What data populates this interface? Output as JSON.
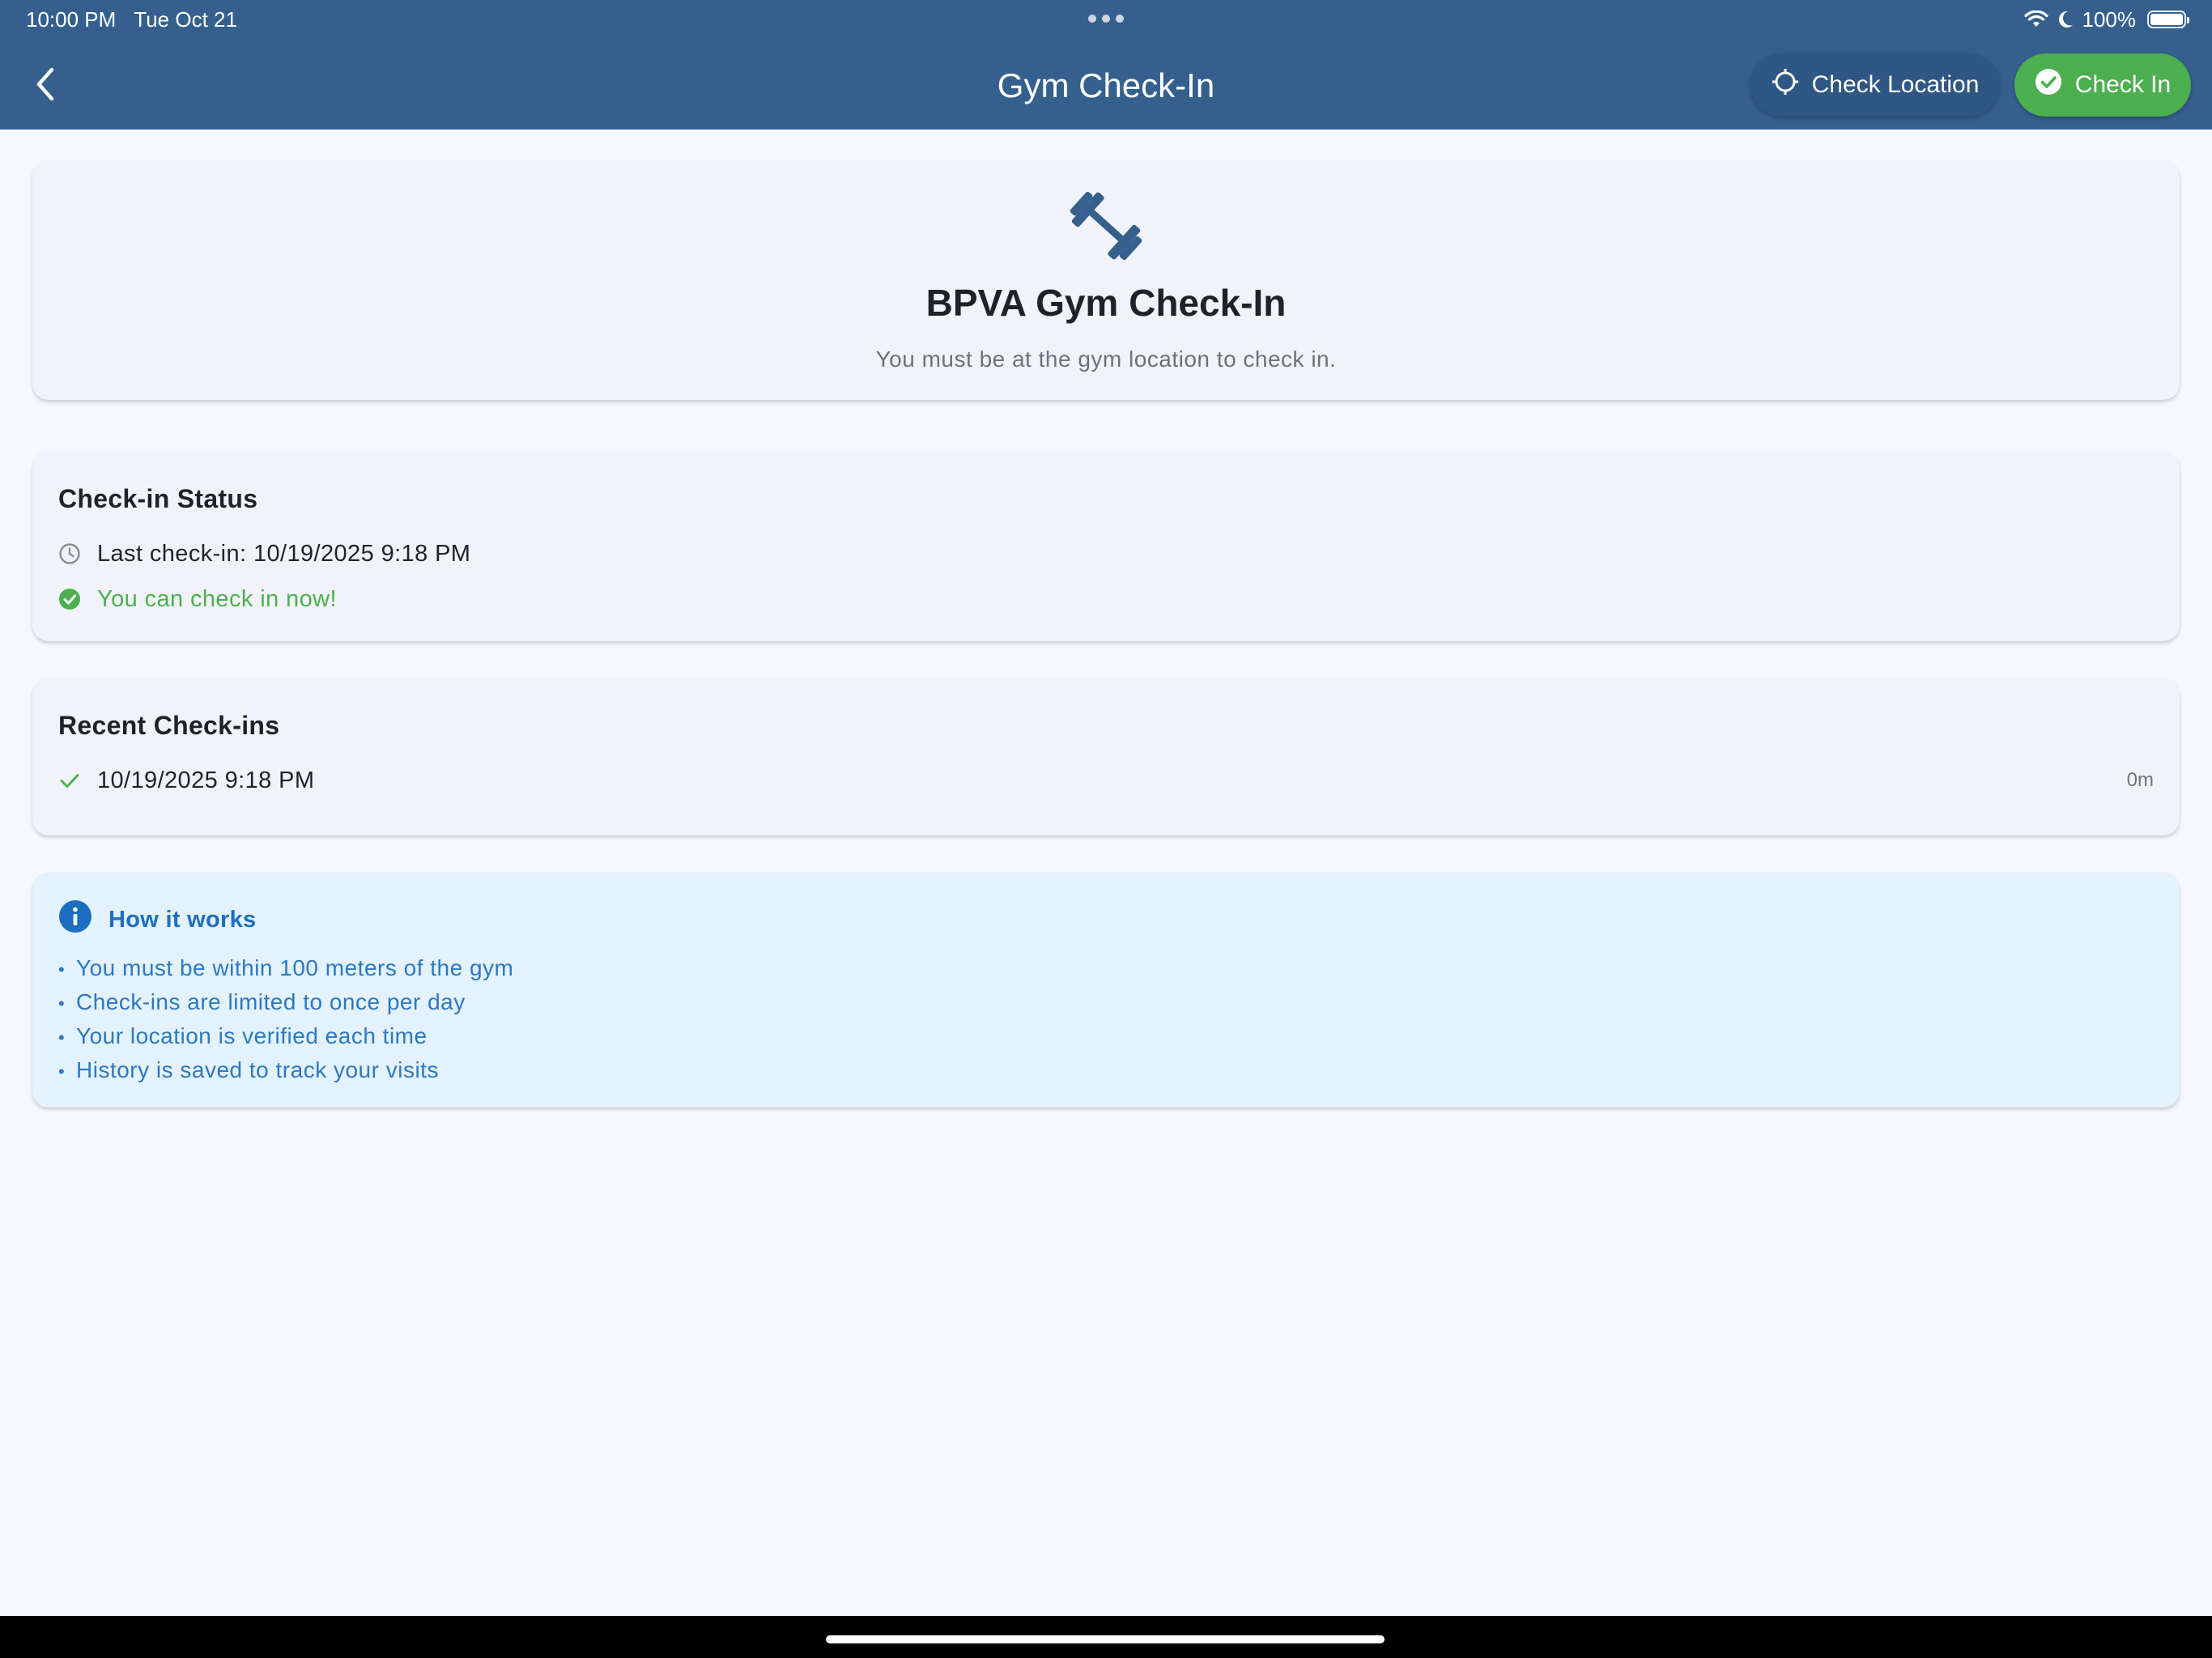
{
  "status_bar": {
    "time": "10:00 PM",
    "date": "Tue Oct 21",
    "battery": "100%",
    "icons": [
      "wifi-icon",
      "moon-icon",
      "battery-icon"
    ]
  },
  "app_bar": {
    "title": "Gym Check-In",
    "back_icon": "chevron-left-icon",
    "check_location_label": "Check Location",
    "check_location_icon": "crosshair-icon",
    "check_in_label": "Check In",
    "check_in_icon": "check-circle-icon"
  },
  "hero": {
    "icon": "dumbbell-icon",
    "title": "BPVA Gym Check-In",
    "subtitle": "You must be at the gym location to check in."
  },
  "status_card": {
    "heading": "Check-in Status",
    "last_checkin": "Last check-in: 10/19/2025 9:18 PM",
    "availability": "You can check in now!"
  },
  "recent_card": {
    "heading": "Recent Check-ins",
    "items": [
      {
        "datetime": "10/19/2025 9:18 PM",
        "duration": "0m"
      }
    ]
  },
  "info_card": {
    "heading": "How it works",
    "items": [
      "You must be within 100 meters of the gym",
      "Check-ins are limited to once per day",
      "Your location is verified each time",
      "History is saved to track your visits"
    ]
  },
  "colors": {
    "app_bar": "#35608e",
    "check_in_button": "#4caf50",
    "success": "#4caf50",
    "info_background": "#e3f2fc",
    "info_text": "#1c6fc0",
    "page_background": "#f6f8fd"
  }
}
